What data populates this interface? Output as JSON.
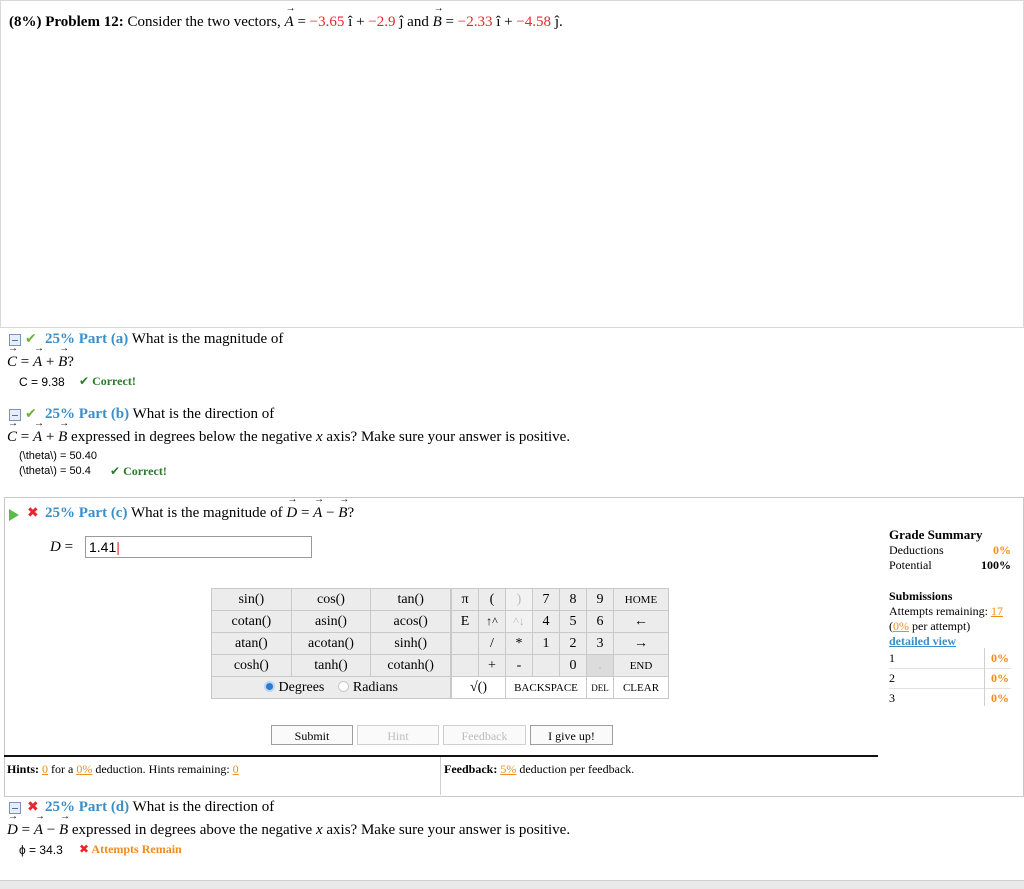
{
  "problem": {
    "weight": "(8%)",
    "label": "Problem 12:",
    "text": "Consider the two vectors,",
    "vecA": "A",
    "eq": "=",
    "ax": "−3.65",
    "i_hat": "î",
    "plus": "+",
    "ay": "−2.9",
    "j_hat": "ĵ",
    "and": "and",
    "vecB": "B",
    "bx": "−2.33",
    "by": "−4.58",
    "period": "."
  },
  "part_a": {
    "pct": "25% Part (a)",
    "question": "What is the magnitude of",
    "expr_C": "C",
    "expr_A": "A",
    "expr_B": "B",
    "tail": "?",
    "answer": "C = 9.38",
    "status": "Correct!"
  },
  "part_b": {
    "pct": "25% Part (b)",
    "question": "What is the direction of",
    "expr_C": "C",
    "expr_A": "A",
    "expr_B": "B",
    "tail": "expressed in degrees below the negative",
    "axis": "x",
    "tail2": "axis? Make sure your answer is positive.",
    "answer1": "(\\theta\\) = 50.40",
    "answer2": "(\\theta\\) = 50.4",
    "status": "Correct!"
  },
  "part_c": {
    "pct": "25% Part (c)",
    "question": "What is the magnitude of",
    "expr_D": "D",
    "expr_A": "A",
    "expr_B": "B",
    "tail": "?",
    "input_label": "D",
    "input_value": "1.41",
    "keypad": {
      "functions": [
        [
          "sin()",
          "cos()",
          "tan()"
        ],
        [
          "cotan()",
          "asin()",
          "acos()"
        ],
        [
          "atan()",
          "acotan()",
          "sinh()"
        ],
        [
          "cosh()",
          "tanh()",
          "cotanh()"
        ]
      ],
      "symbols": [
        [
          "π",
          "(",
          ")"
        ],
        [
          "E",
          "↑^",
          "^↓"
        ],
        [
          "",
          "/",
          "*"
        ],
        [
          "",
          "+",
          "-"
        ]
      ],
      "digits": [
        [
          "7",
          "8",
          "9",
          "HOME"
        ],
        [
          "4",
          "5",
          "6",
          "←"
        ],
        [
          "1",
          "2",
          "3",
          "→"
        ],
        [
          "",
          "0",
          ".",
          "END"
        ]
      ],
      "sqrt": "√()",
      "backspace": "BACKSPACE",
      "del": "DEL",
      "clear": "CLEAR",
      "degrees": "Degrees",
      "radians": "Radians"
    },
    "buttons": {
      "submit": "Submit",
      "hint": "Hint",
      "feedback": "Feedback",
      "give_up": "I give up!"
    },
    "hints": {
      "label": "Hints:",
      "count": "0",
      "for_a": "for a",
      "pct": "0%",
      "deduction": "deduction. Hints remaining:",
      "remaining": "0"
    },
    "feedback": {
      "label": "Feedback:",
      "pct": "5%",
      "text": "deduction per feedback."
    }
  },
  "grade_summary": {
    "title": "Grade Summary",
    "deductions_label": "Deductions",
    "deductions_value": "0%",
    "potential_label": "Potential",
    "potential_value": "100%",
    "submissions_title": "Submissions",
    "attempts_label": "Attempts remaining:",
    "attempts_value": "17",
    "per_attempt_pct": "0%",
    "per_attempt_text": "per attempt)",
    "detailed_view": "detailed view",
    "rows": [
      {
        "n": "1",
        "v": "0%"
      },
      {
        "n": "2",
        "v": "0%"
      },
      {
        "n": "3",
        "v": "0%"
      }
    ]
  },
  "part_d": {
    "pct": "25% Part (d)",
    "question": "What is the direction of",
    "expr_D": "D",
    "expr_A": "A",
    "expr_B": "B",
    "tail": "expressed in degrees above the negative",
    "axis": "x",
    "tail2": "axis? Make sure your answer is positive.",
    "answer": "ϕ = 34.3",
    "status": "Attempts Remain"
  },
  "colors": {
    "accent_blue": "#3a8fc9",
    "error_red": "#e8262b",
    "orange": "#f08c1c",
    "green_check": "#6fb23d"
  }
}
